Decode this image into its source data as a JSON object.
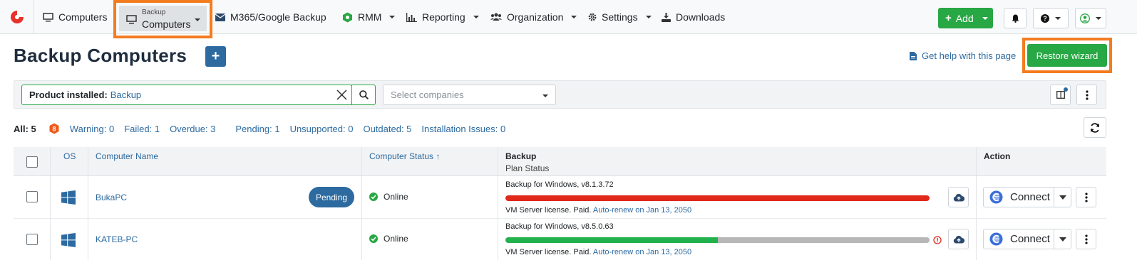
{
  "nav": {
    "computers": "Computers",
    "backup_top": "Backup",
    "backup_bottom": "Computers",
    "m365": "M365/Google Backup",
    "rmm": "RMM",
    "reporting": "Reporting",
    "organization": "Organization",
    "settings": "Settings",
    "downloads": "Downloads",
    "add": "Add"
  },
  "header": {
    "title": "Backup Computers",
    "help": "Get help with this page",
    "restore": "Restore wizard"
  },
  "filter": {
    "label": "Product installed:",
    "value": "Backup",
    "company_placeholder": "Select companies"
  },
  "counts": {
    "all": "All: 5",
    "warning": "Warning: 0",
    "failed": "Failed: 1",
    "overdue": "Overdue: 3",
    "pending": "Pending: 1",
    "unsupported": "Unsupported: 0",
    "outdated": "Outdated: 5",
    "issues": "Installation Issues: 0"
  },
  "table": {
    "headers": {
      "os": "OS",
      "name": "Computer Name",
      "status": "Computer Status",
      "backup": "Backup",
      "plan_status": "Plan Status",
      "action": "Action"
    },
    "rows": [
      {
        "name": "BukaPC",
        "badge": "Pending",
        "status": "Online",
        "plan": "Backup for Windows, v8.1.3.72",
        "progress": 1.0,
        "progress_color": "#e0281b",
        "license": "VM Server license. Paid.",
        "renew": "Auto-renew on Jan 13, 2050",
        "connect": "Connect"
      },
      {
        "name": "KATEB-PC",
        "status": "Online",
        "plan": "Backup for Windows, v8.5.0.63",
        "progress": 0.5,
        "progress_color": "#22b14c",
        "license": "VM Server license. Paid.",
        "renew": "Auto-renew on Jan 13, 2050",
        "connect": "Connect"
      }
    ]
  },
  "colors": {
    "accent": "#2c6aa0",
    "success": "#28a745",
    "highlight": "#f47c20",
    "danger": "#e0281b"
  }
}
